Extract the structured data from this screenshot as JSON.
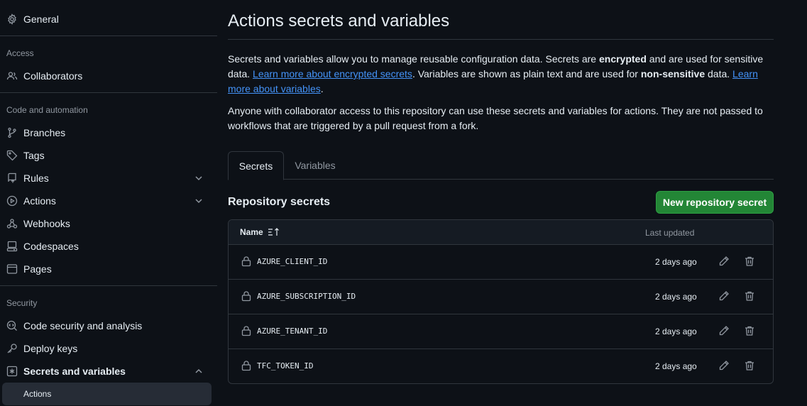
{
  "sidebar": {
    "general": "General",
    "access_title": "Access",
    "collaborators": "Collaborators",
    "code_title": "Code and automation",
    "branches": "Branches",
    "tags": "Tags",
    "rules": "Rules",
    "actions": "Actions",
    "webhooks": "Webhooks",
    "codespaces": "Codespaces",
    "pages": "Pages",
    "security_title": "Security",
    "code_security": "Code security and analysis",
    "deploy_keys": "Deploy keys",
    "secrets_vars": "Secrets and variables",
    "sub_actions": "Actions"
  },
  "main": {
    "title": "Actions secrets and variables",
    "p1_a": "Secrets and variables allow you to manage reusable configuration data. Secrets are ",
    "p1_b": "encrypted",
    "p1_c": " and are used for sensitive data. ",
    "p1_link1": "Learn more about encrypted secrets",
    "p1_d": ". Variables are shown as plain text and are used for ",
    "p1_e": "non-sensitive",
    "p1_f": " data. ",
    "p1_link2": "Learn more about variables",
    "p1_g": ".",
    "p2": "Anyone with collaborator access to this repository can use these secrets and variables for actions. They are not passed to workflows that are triggered by a pull request from a fork.",
    "tab_secrets": "Secrets",
    "tab_variables": "Variables",
    "repo_secrets_heading": "Repository secrets",
    "new_secret_button": "New repository secret",
    "col_name": "Name",
    "col_updated": "Last updated",
    "secrets": [
      {
        "name": "AZURE_CLIENT_ID",
        "updated": "2 days ago"
      },
      {
        "name": "AZURE_SUBSCRIPTION_ID",
        "updated": "2 days ago"
      },
      {
        "name": "AZURE_TENANT_ID",
        "updated": "2 days ago"
      },
      {
        "name": "TFC_TOKEN_ID",
        "updated": "2 days ago"
      }
    ]
  },
  "icons": {
    "general": "gear-icon",
    "collaborators": "people-icon",
    "branches": "git-branch-icon",
    "tags": "tag-icon",
    "rules": "repo-push-icon",
    "actions": "play-icon",
    "webhooks": "webhook-icon",
    "codespaces": "codespaces-icon",
    "pages": "browser-icon",
    "code_security": "codescan-icon",
    "deploy_keys": "key-icon",
    "secrets_vars": "asterisk-icon",
    "sort": "sort-asc-icon",
    "lock": "lock-icon",
    "edit": "pencil-icon",
    "delete": "trash-icon"
  },
  "colors": {
    "background": "#0d1117",
    "accent_link": "#4493f8",
    "primary_button": "#238636",
    "border": "#30363d",
    "muted_text": "#9198a1"
  }
}
